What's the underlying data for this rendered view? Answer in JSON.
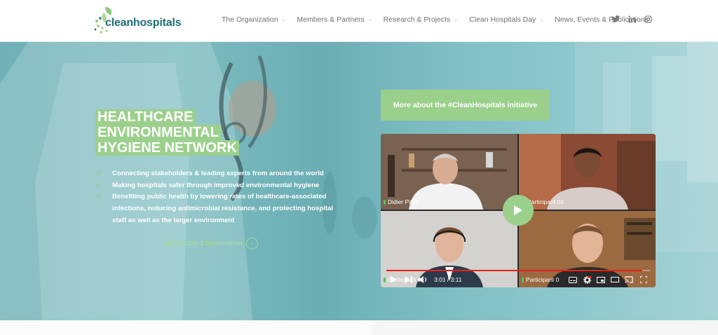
{
  "brand": {
    "name": "cleanhospitals",
    "logo_icon": "leaf-dots-icon",
    "color": "#1d6f77",
    "accent": "#9bd08c"
  },
  "nav": {
    "items": [
      {
        "label": "The Organization",
        "dropdown": true
      },
      {
        "label": "Members & Partners",
        "dropdown": true
      },
      {
        "label": "Research & Projects",
        "dropdown": true
      },
      {
        "label": "Clean Hospitals Day",
        "dropdown": true
      },
      {
        "label": "News, Events & Publications",
        "dropdown": false
      }
    ],
    "chevron": "⌄"
  },
  "social": [
    "twitter-icon",
    "linkedin-icon",
    "instagram-icon"
  ],
  "hero": {
    "headline": [
      "HEALTHCARE",
      "ENVIRONMENTAL",
      "HYGIENE NETWORK"
    ],
    "bullets": [
      "Connecting stakeholders & leading experts from around the world",
      "Making hospitals safer through improved environmental hygiene",
      "Benefiting public health by lowering rates of healthcare-associated infections, reducing antimicrobial resistance, and protecting hospital staff as well as the larger environment"
    ],
    "check": "✔",
    "sars_link": "SARS-COV-2 information",
    "sars_arrow": "›",
    "more_button": "More about the #CleanHospitals initiative"
  },
  "video": {
    "participants": [
      "Didier Pittet",
      "Participant 03",
      "Participant 0",
      "Participant 0"
    ],
    "time": "3:01 / 3:11",
    "progress_fraction": 0.97
  }
}
